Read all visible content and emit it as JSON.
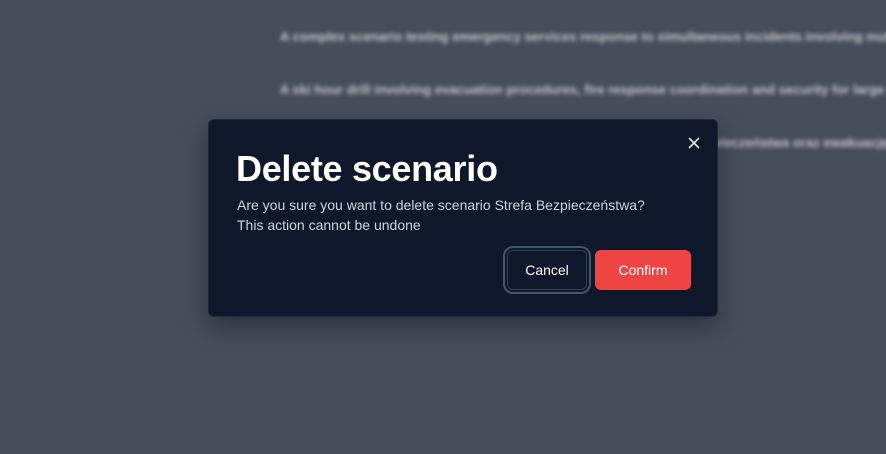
{
  "background": {
    "lines": [
      "A complex scenario testing emergency services response to simultaneous incidents involving multiple agencies and resources",
      "A ski hour drill involving evacuation procedures, fire response coordination and security for large crowds in the area",
      "Ćwiczenie praktyczne obejmujące scenariusz zagrożenia w strefie bezpieczeństwa oraz ewakuację na różne zagrożenia"
    ]
  },
  "dialog": {
    "title": "Delete scenario",
    "description_line1": "Are you sure you want to delete scenario Strefa Bezpieczeństwa?",
    "description_line2": "This action cannot be undone",
    "cancel_label": "Cancel",
    "confirm_label": "Confirm",
    "close_icon": "close-icon"
  },
  "colors": {
    "backdrop": "#4b5260",
    "dialog_bg": "#0f172a",
    "confirm": "#ef4444",
    "text_primary": "#ffffff",
    "text_secondary": "#cbd5e1"
  }
}
